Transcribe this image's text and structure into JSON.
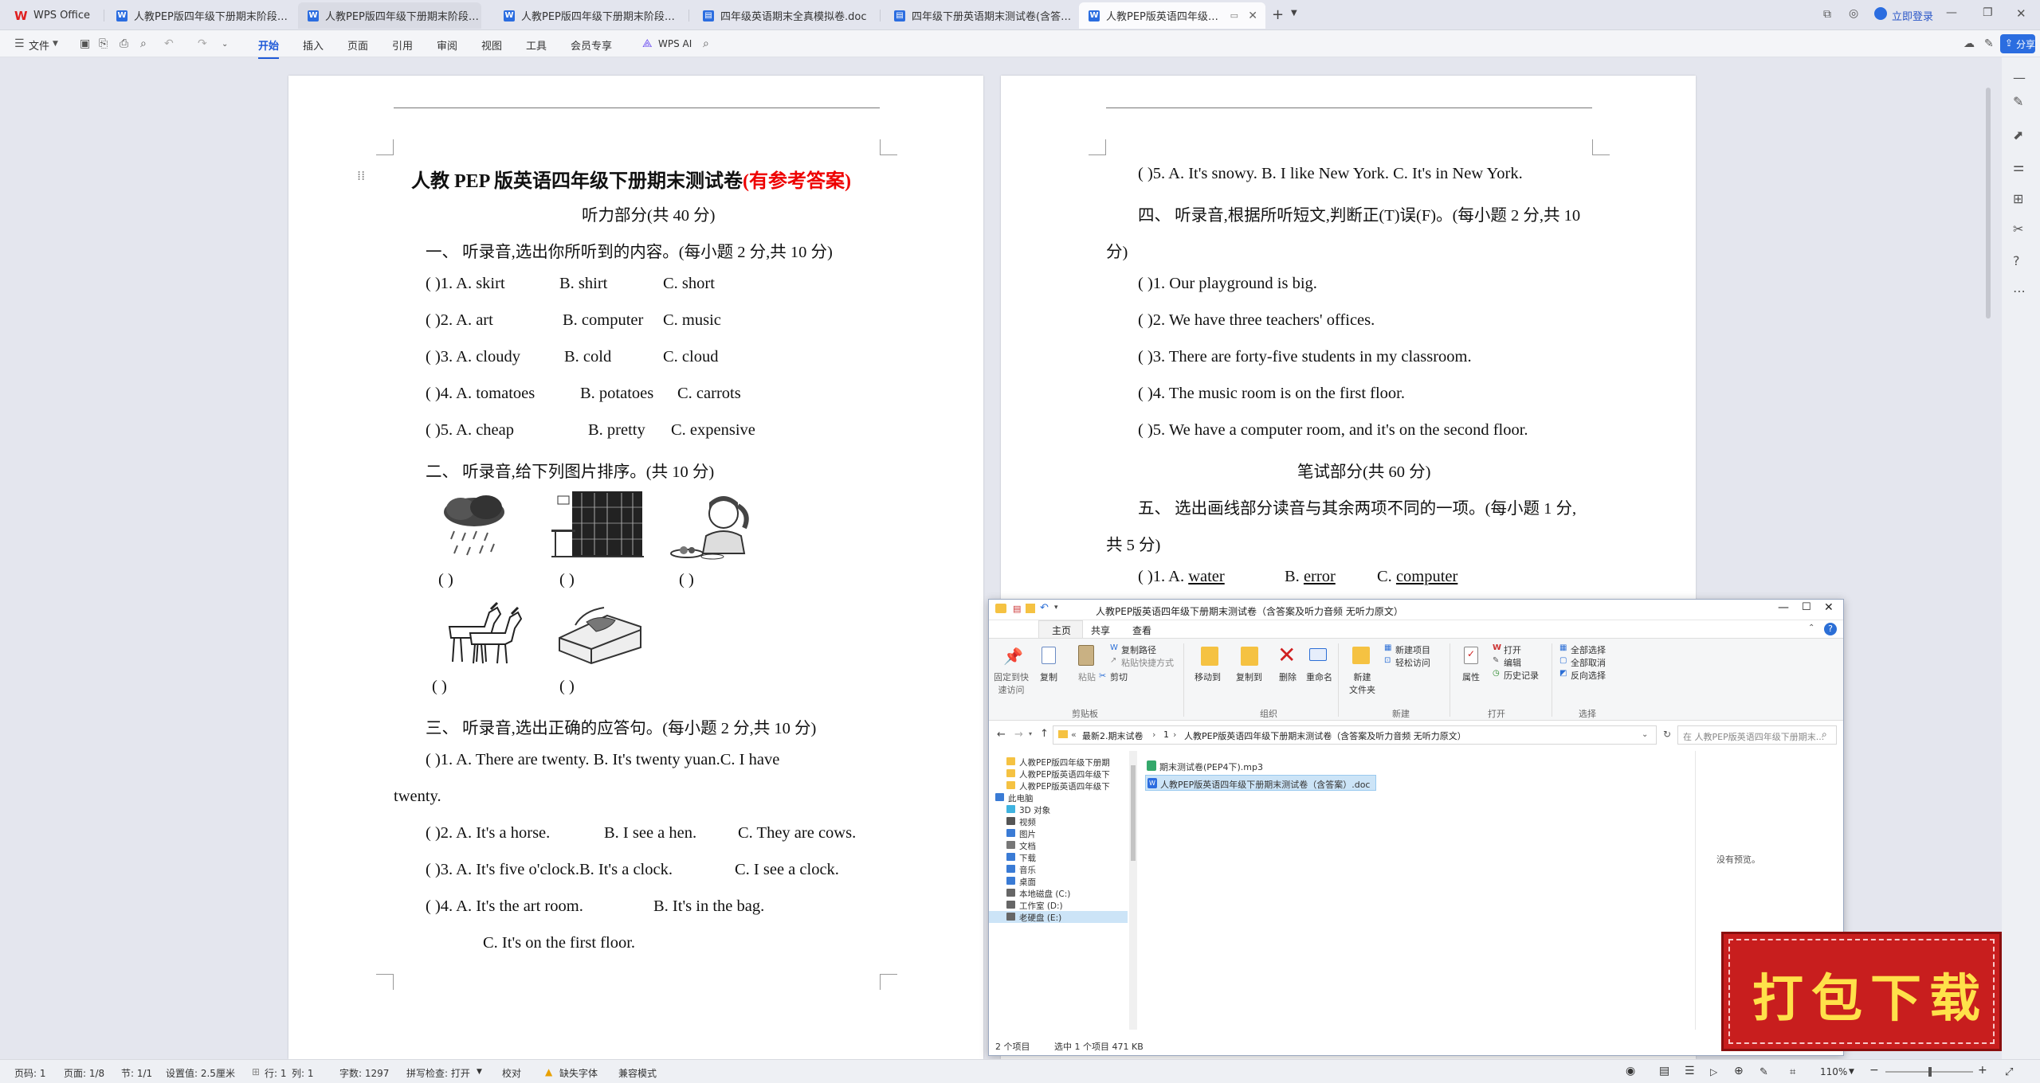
{
  "tabs": [
    {
      "label": "WPS Office"
    },
    {
      "label": "人教PEP版四年级下册期末阶段质量检"
    },
    {
      "label": "人教PEP版四年级下册期末阶段质量检"
    },
    {
      "label": "人教PEP版四年级下册期末阶段质量检"
    },
    {
      "label": "四年级英语期末全真模拟卷.doc"
    },
    {
      "label": "四年级下册英语期末测试卷(含答案).d"
    },
    {
      "label": "人教PEP版英语四年级下册期"
    }
  ],
  "titlebar": {
    "login": "立即登录"
  },
  "menu": {
    "file": "文件",
    "items": [
      "开始",
      "插入",
      "页面",
      "引用",
      "审阅",
      "视图",
      "工具",
      "会员专享"
    ],
    "ai": "WPS AI",
    "share": "分享"
  },
  "page1": {
    "title": "人教 PEP 版英语四年级下册期末测试卷",
    "title_red": "(有参考答案)",
    "l1": "听力部分(共 40 分)",
    "l2": "一、 听录音,选出你所听到的内容。(每小题 2 分,共 10 分)",
    "q1": [
      "(        )1. A. skirt",
      "B. shirt",
      "C. short"
    ],
    "q2": [
      "(        )2. A. art",
      "B. computer",
      "C. music"
    ],
    "q3": [
      "(        )3. A. cloudy",
      "B. cold",
      "C. cloud"
    ],
    "q4": [
      "(        )4. A. tomatoes",
      "B. potatoes",
      "C. carrots"
    ],
    "q5": [
      "(        )5. A. cheap",
      "B. pretty",
      "C. expensive"
    ],
    "l3": "二、 听录音,给下列图片排序。(共 10 分)",
    "paren": "(          )",
    "l4": "三、 听录音,选出正确的应答句。(每小题 2 分,共 10 分)",
    "s1a": "(        )1.    A. There are twenty.  B.    It's    twenty    yuan.C.    I    have",
    "s1b": "twenty.",
    "s2": [
      "(        )2. A. It's a horse.",
      "B. I see a hen.",
      "C. They are cows."
    ],
    "s3": [
      "(        )3. A. It's five o'clock.B. It's a clock.",
      "C. I see a clock."
    ],
    "s4": [
      "(        )4. A. It's the art room.",
      "B. It's in the bag."
    ],
    "s4c": "C. It's on the first floor."
  },
  "page2": {
    "r1": "(        )5. A. It's snowy.      B. I like New York.  C. It's in New York.",
    "r2a": "四、 听录音,根据所听短文,判断正(T)误(F)。(每小题 2 分,共 10",
    "r2b": "分)",
    "t1": "(        )1. Our playground is big.",
    "t2": "(        )2. We have three teachers' offices.",
    "t3": "(        )3. There are forty-five students in my classroom.",
    "t4": "(        )4. The music room is on the first floor.",
    "t5": "(        )5. We have a computer room, and it's on the second floor.",
    "r3": "笔试部分(共 60 分)",
    "r4a": "五、 选出画线部分读音与其余两项不同的一项。(每小题 1 分,",
    "r4b": "共 5 分)",
    "w1a": "(        )1. A. ",
    "w1w": "water",
    "w1b": "B. ",
    "w1e": "error",
    "w1c": "C. ",
    "w1cm": "computer"
  },
  "explorer": {
    "title": "人教PEP版英语四年级下册期末测试卷（含答案及听力音频 无听力原文）",
    "tabs": [
      "主页",
      "共享",
      "查看"
    ],
    "clipboard": {
      "pin": "固定到快\n速访问",
      "copy": "复制",
      "paste": "粘贴",
      "copypath": "复制路径",
      "pasteshortcut": "粘贴快捷方式",
      "cut": "剪切",
      "group": "剪贴板"
    },
    "organize": {
      "move": "移动到",
      "copyto": "复制到",
      "delete": "删除",
      "rename": "重命名",
      "group": "组织"
    },
    "new": {
      "folder": "新建\n文件夹",
      "item": "新建项目",
      "easy": "轻松访问",
      "group": "新建"
    },
    "open": {
      "props": "属性",
      "open": "打开",
      "edit": "编辑",
      "history": "历史记录",
      "group": "打开"
    },
    "select": {
      "all": "全部选择",
      "none": "全部取消",
      "invert": "反向选择",
      "group": "选择"
    },
    "path": [
      "最新2.期末试卷",
      "1",
      "人教PEP版英语四年级下册期末测试卷（含答案及听力音频 无听力原文）"
    ],
    "search_placeholder": "在 人教PEP版英语四年级下册期末...",
    "nav": [
      "人教PEP版四年级下册期",
      "人教PEP版英语四年级下",
      "人教PEP版英语四年级下",
      "此电脑",
      "3D 对象",
      "视频",
      "图片",
      "文档",
      "下载",
      "音乐",
      "桌面",
      "本地磁盘 (C:)",
      "工作室 (D:)",
      "老硬盘 (E:)"
    ],
    "files": [
      "期末测试卷(PEP4下).mp3",
      "人教PEP版英语四年级下册期末测试卷（含答案）.doc"
    ],
    "preview": "没有预览。",
    "status": [
      "2 个项目",
      "选中 1 个项目  471 KB"
    ]
  },
  "status": {
    "page": "页码: 1",
    "pages": "页面: 1/8",
    "section": "节: 1/1",
    "setting": "设置值: 2.5厘米",
    "row": "行: 1",
    "col": "列: 1",
    "words": "字数: 1297",
    "spell": "拼写检查: 打开",
    "proof": "校对",
    "font": "缺失字体",
    "compat": "兼容模式",
    "zoom": "110%"
  },
  "promo": "打包下载"
}
